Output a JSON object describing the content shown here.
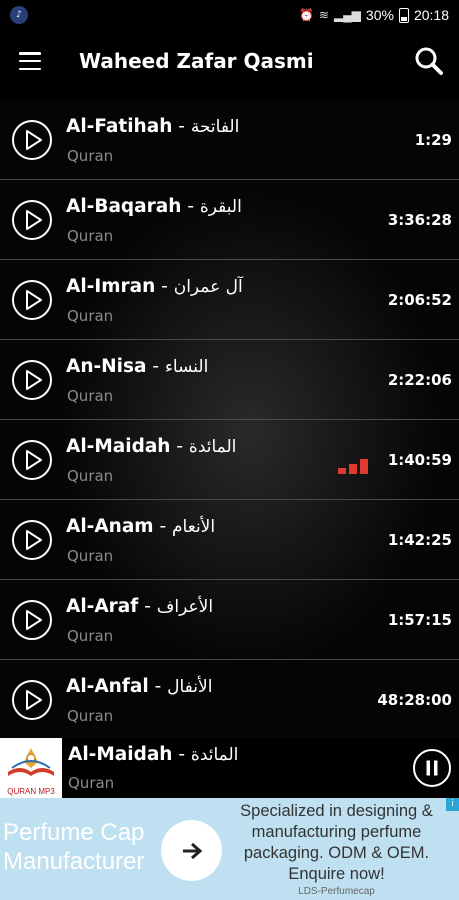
{
  "status_bar": {
    "battery": "30%",
    "time": "20:18"
  },
  "header": {
    "title": "Waheed Zafar Qasmi",
    "menu_icon": "hamburger-menu-icon",
    "search_icon": "search-icon"
  },
  "tracks": [
    {
      "name": "Al-Fatihah",
      "arabic": "الفاتحة",
      "subtitle": "Quran",
      "duration": "1:29",
      "playing": false
    },
    {
      "name": "Al-Baqarah",
      "arabic": "البقرة",
      "subtitle": "Quran",
      "duration": "3:36:28",
      "playing": false
    },
    {
      "name": "Al-Imran",
      "arabic": "آل عمران",
      "subtitle": "Quran",
      "duration": "2:06:52",
      "playing": false
    },
    {
      "name": "An-Nisa",
      "arabic": "النساء",
      "subtitle": "Quran",
      "duration": "2:22:06",
      "playing": false
    },
    {
      "name": "Al-Maidah",
      "arabic": "المائدة",
      "subtitle": "Quran",
      "duration": "1:40:59",
      "playing": true
    },
    {
      "name": "Al-Anam",
      "arabic": "الأنعام",
      "subtitle": "Quran",
      "duration": "1:42:25",
      "playing": false
    },
    {
      "name": "Al-Araf",
      "arabic": "الأعراف",
      "subtitle": "Quran",
      "duration": "1:57:15",
      "playing": false
    },
    {
      "name": "Al-Anfal",
      "arabic": "الأنفال",
      "subtitle": "Quran",
      "duration": "48:28:00",
      "playing": false
    }
  ],
  "separator": " - ",
  "now_playing": {
    "name": "Al-Maidah",
    "arabic": "المائدة",
    "subtitle": "Quran",
    "cover_label": "QURAN MP3"
  },
  "ad": {
    "title_line1": "Perfume Cap",
    "title_line2": "Manufacturer",
    "body": "Specialized in designing & manufacturing perfume packaging. ODM & OEM. Enquire now!",
    "source": "LDS-Perfumecap"
  },
  "colors": {
    "background": "#000000",
    "accent_red": "#e03a2f",
    "muted_text": "#8a8a8a",
    "divider": "#4a4a4a",
    "ad_background": "#bfe0f0"
  }
}
